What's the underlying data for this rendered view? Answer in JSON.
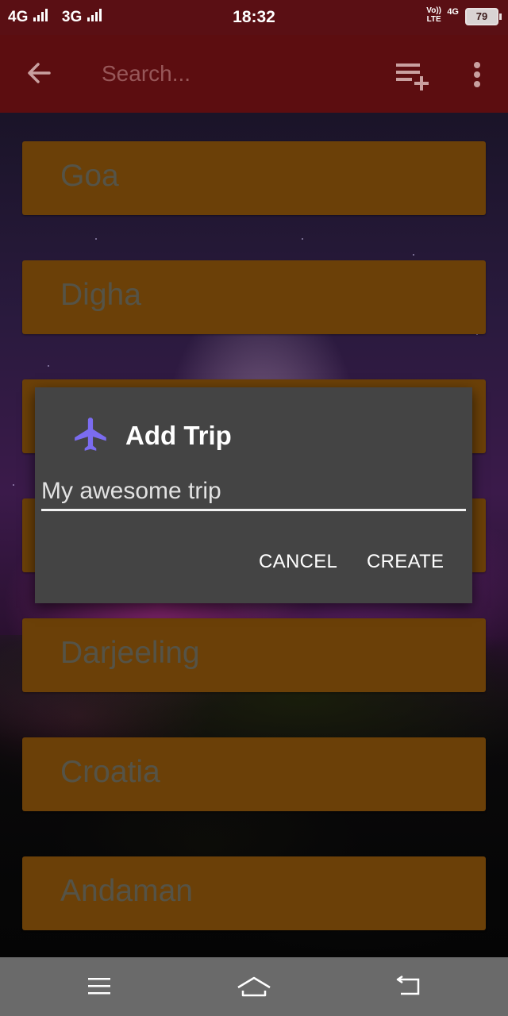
{
  "status_bar": {
    "network_1": "4G",
    "network_2": "3G",
    "time": "18:32",
    "volte_line1": "Vo))",
    "volte_line2": "LTE",
    "data_network": "4G",
    "battery": "79"
  },
  "app_bar": {
    "search_placeholder": "Search..."
  },
  "trips": [
    "Goa",
    "Digha",
    "",
    "",
    "Darjeeling",
    "Croatia",
    "Andaman"
  ],
  "dialog": {
    "title": "Add Trip",
    "input_placeholder": "My awesome trip",
    "cancel_label": "CANCEL",
    "create_label": "CREATE"
  },
  "icons": {
    "back": "arrow-left-icon",
    "add_list": "playlist-add-icon",
    "overflow": "more-vert-icon",
    "dialog": "airplane-icon",
    "nav_menu": "menu-icon",
    "nav_home": "home-icon",
    "nav_back": "back-icon"
  },
  "colors": {
    "status_bar": "#5a0f14",
    "app_bar": "#5c0d10",
    "trip_card": "#6b4008",
    "dialog_bg": "#444444",
    "dialog_icon": "#7b6cf0",
    "nav_bar": "#6a6a6a"
  }
}
